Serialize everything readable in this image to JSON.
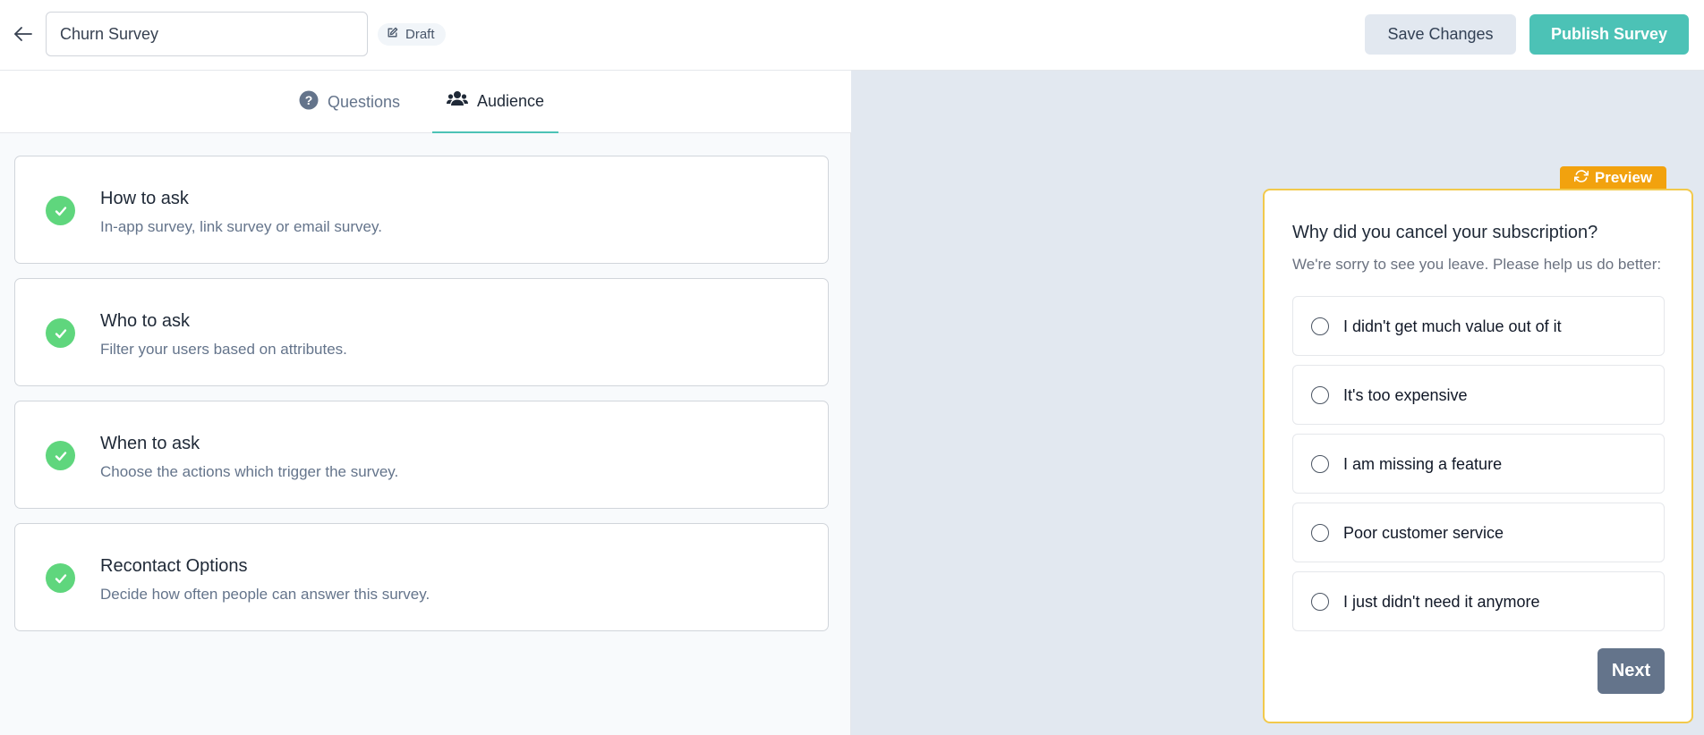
{
  "header": {
    "back_icon": "arrow-left-icon",
    "survey_name": "Churn Survey",
    "status_badge": "Draft",
    "save_label": "Save Changes",
    "publish_label": "Publish Survey"
  },
  "tabs": [
    {
      "label": "Questions",
      "icon": "question-circle-icon",
      "active": false
    },
    {
      "label": "Audience",
      "icon": "users-icon",
      "active": true
    }
  ],
  "settings_cards": [
    {
      "title": "How to ask",
      "description": "In-app survey, link survey or email survey.",
      "completed": true
    },
    {
      "title": "Who to ask",
      "description": "Filter your users based on attributes.",
      "completed": true
    },
    {
      "title": "When to ask",
      "description": "Choose the actions which trigger the survey.",
      "completed": true
    },
    {
      "title": "Recontact Options",
      "description": "Decide how often people can answer this survey.",
      "completed": true
    }
  ],
  "preview": {
    "tag_label": "Preview",
    "question": "Why did you cancel your subscription?",
    "subheader": "We're sorry to see you leave. Please help us do better:",
    "options": [
      "I didn't get much value out of it",
      "It's too expensive",
      "I am missing a feature",
      "Poor customer service",
      "I just didn't need it anymore"
    ],
    "next_label": "Next"
  },
  "colors": {
    "brand_teal": "#4cc2b6",
    "check_green": "#5fd67d",
    "preview_orange": "#f2a20e",
    "preview_border": "#f2c94c",
    "next_button": "#64748b"
  }
}
